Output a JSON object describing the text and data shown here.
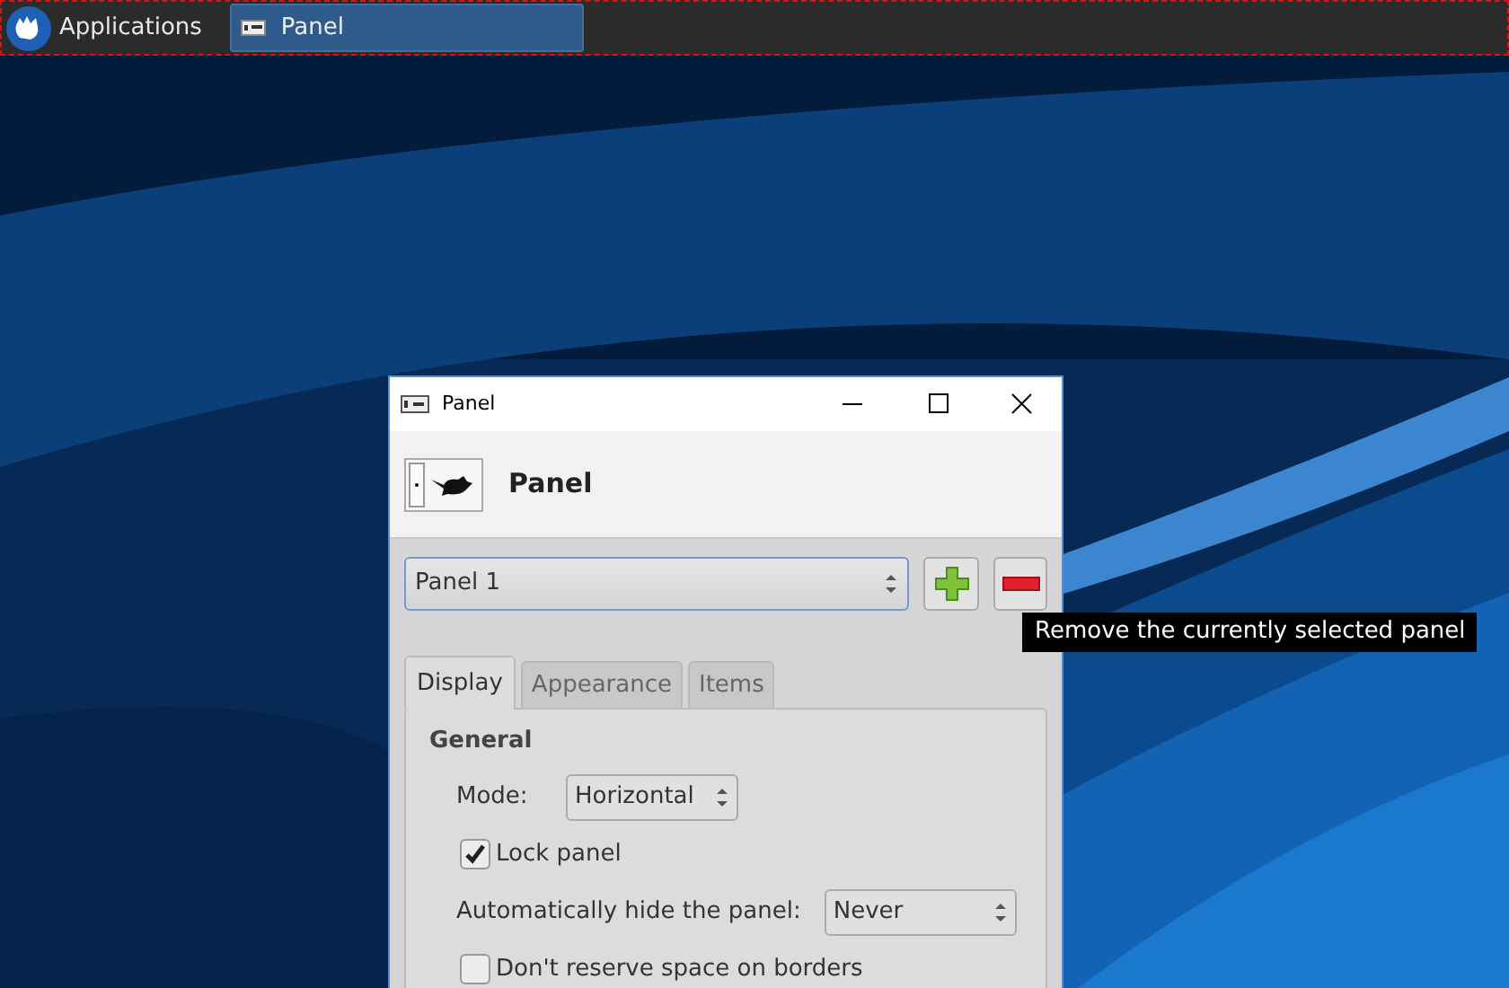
{
  "top_panel": {
    "applications_label": "Applications",
    "tasks": [
      {
        "label": "Panel",
        "selected": true
      }
    ]
  },
  "window": {
    "title": "Panel",
    "header_title": "Panel",
    "panel_select": {
      "value": "Panel 1"
    },
    "tooltip": "Remove the currently selected panel",
    "tabs": [
      {
        "label": "Display",
        "selected": true
      },
      {
        "label": "Appearance",
        "selected": false
      },
      {
        "label": "Items",
        "selected": false
      }
    ],
    "section_title": "General",
    "fields": [
      {
        "kind": "select",
        "label": "Mode:",
        "value": "Horizontal"
      },
      {
        "kind": "checkbox",
        "label": "Lock panel",
        "checked": true
      },
      {
        "kind": "select",
        "label": "Automatically hide the panel:",
        "value": "Never"
      },
      {
        "kind": "checkbox",
        "label": "Don't reserve space on borders",
        "checked": false
      }
    ]
  }
}
